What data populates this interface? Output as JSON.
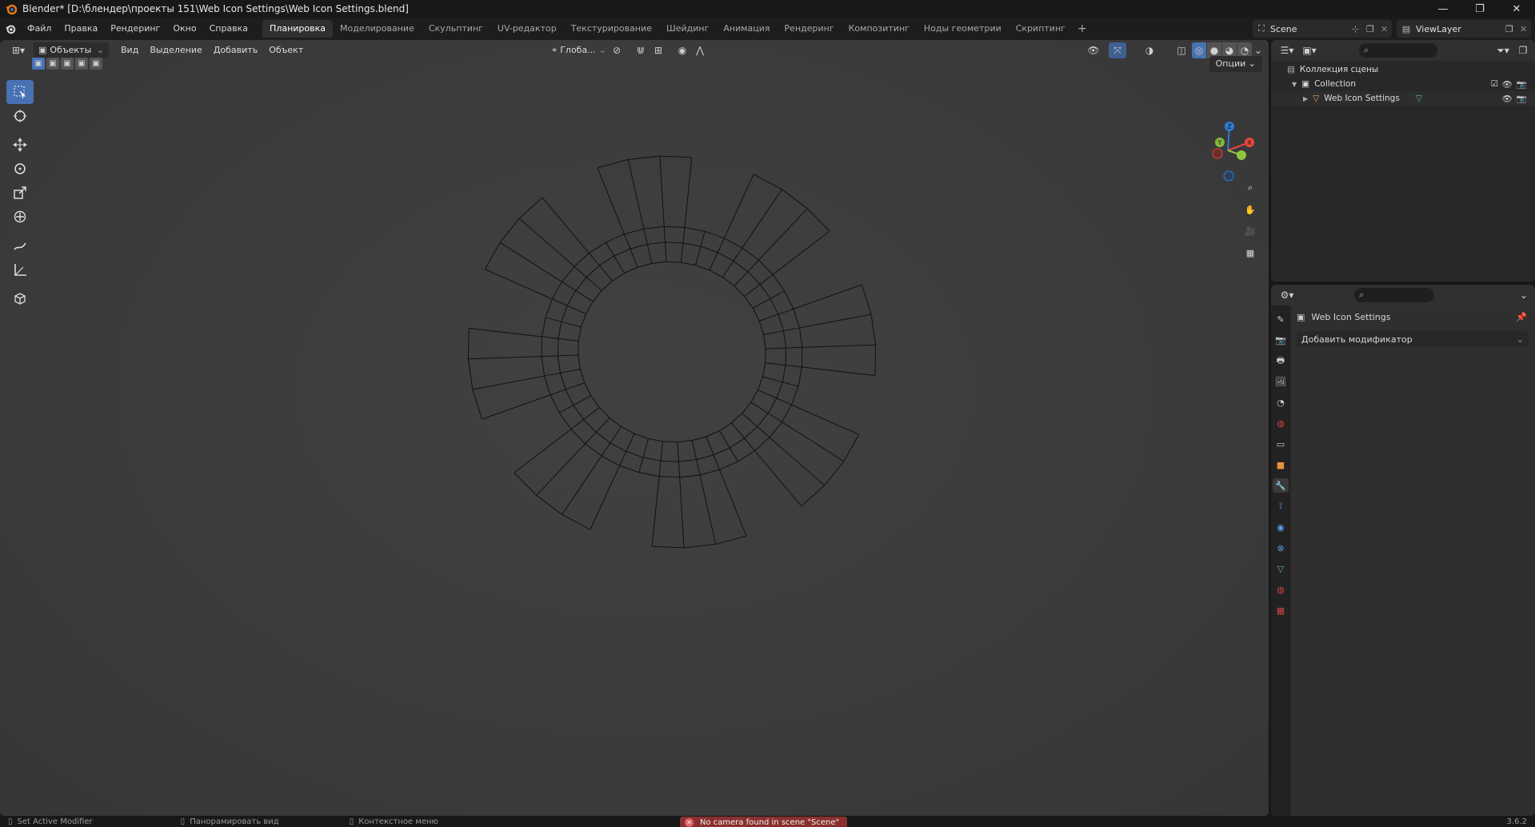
{
  "window": {
    "title": "Blender* [D:\\блендер\\проекты 151\\Web Icon Settings\\Web Icon Settings.blend]",
    "minimize": "—",
    "restore": "❐",
    "close": "✕"
  },
  "menu": {
    "items": [
      "Файл",
      "Правка",
      "Рендеринг",
      "Окно",
      "Справка"
    ]
  },
  "workspaces": {
    "tabs": [
      "Планировка",
      "Моделирование",
      "Скульптинг",
      "UV-редактор",
      "Текстурирование",
      "Шейдинг",
      "Анимация",
      "Рендеринг",
      "Композитинг",
      "Ноды геометрии",
      "Скриптинг"
    ],
    "active": "Планировка",
    "add": "+"
  },
  "scene": {
    "name": "Scene",
    "view_layer": "ViewLayer"
  },
  "viewport": {
    "mode": "Объекты",
    "menus": [
      "Вид",
      "Выделение",
      "Добавить",
      "Объект"
    ],
    "transform_orientation": "Глоба...",
    "options": "Опции",
    "gizmo": {
      "x": "X",
      "y": "Y",
      "z": "Z"
    }
  },
  "outliner": {
    "scene_collection": "Коллекция сцены",
    "collection": "Collection",
    "object": "Web Icon Settings"
  },
  "properties": {
    "object_name": "Web Icon Settings",
    "add_modifier": "Добавить модификатор"
  },
  "status": {
    "left": "Set Active Modifier",
    "pan": "Панорамировать вид",
    "context": "Контекстное меню",
    "warning": "No camera found in scene \"Scene\"",
    "version": "3.6.2"
  },
  "colors": {
    "accent": "#4772b3",
    "x_axis": "#e8463d",
    "y_axis": "#8ec63f",
    "z_axis": "#2f7bd6",
    "warning_bg": "#8a2f2f"
  }
}
